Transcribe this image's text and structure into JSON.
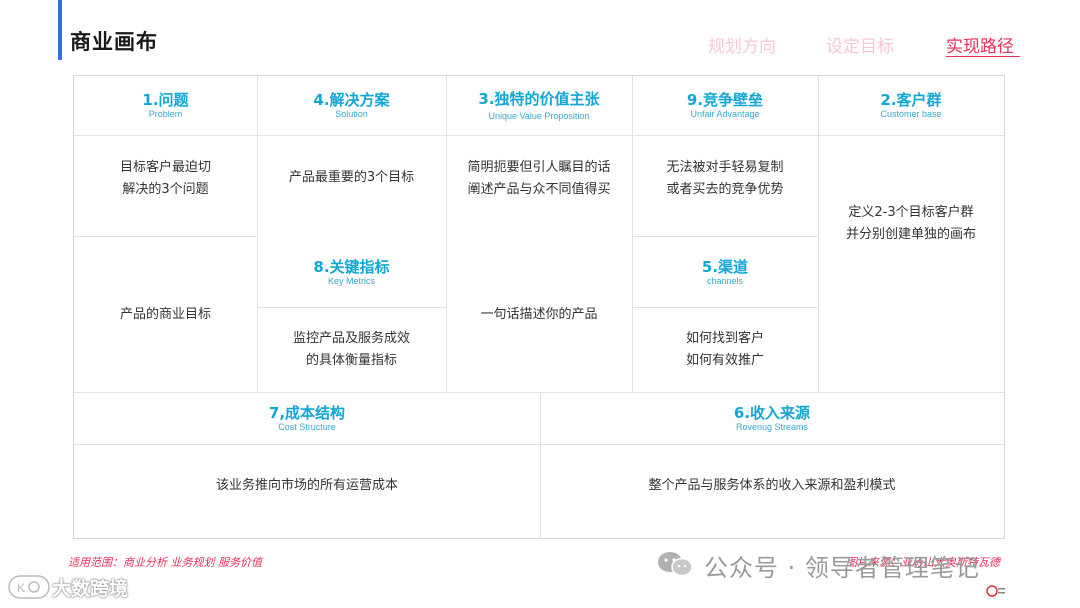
{
  "header": {
    "title": "商业画布",
    "nav": [
      "规划方向",
      "设定目标",
      "实现路径"
    ],
    "active_nav": "实现路径"
  },
  "canvas": {
    "problem": {
      "title": "1.问题",
      "subtitle": "Problem",
      "body1": [
        "目标客户最迫切",
        "解决的3个问题"
      ],
      "body2": [
        "产品的商业目标"
      ]
    },
    "solution": {
      "title": "4.解决方案",
      "subtitle": "Solution",
      "body": [
        "产品最重要的3个目标"
      ]
    },
    "uvp": {
      "title": "3.独特的价值主张",
      "subtitle": "Unique  Value Proposition",
      "body1": [
        "简明扼要但引人瞩目的话",
        "阐述产品与众不同值得买"
      ],
      "body2": [
        "一句话描述你的产品"
      ]
    },
    "unfair": {
      "title": "9.竞争壁垒",
      "subtitle": "Unfair Advantage",
      "body": [
        "无法被对手轻易复制",
        "或者买去的竞争优势"
      ]
    },
    "customer": {
      "title": "2.客户群",
      "subtitle": "Customer base",
      "body": [
        "定义2-3个目标客户群",
        "并分别创建单独的画布"
      ]
    },
    "metrics": {
      "title": "8.关键指标",
      "subtitle": "Key Metrics",
      "body": [
        "监控产品及服务成效",
        "的具体衡量指标"
      ]
    },
    "channels": {
      "title": "5.渠道",
      "subtitle": "channels",
      "body": [
        "如何找到客户",
        "如何有效推广"
      ]
    },
    "cost": {
      "title": "7,成本结构",
      "subtitle": "Cost Structure",
      "body": [
        "该业务推向市场的所有运营成本"
      ]
    },
    "revenue": {
      "title": "6.收入来源",
      "subtitle": "Rovenug  Streams",
      "body": [
        "整个产品与服务体系的收入来源和盈利模式"
      ]
    }
  },
  "footer": {
    "scope": "适用范围：商业分析 业务规划 服务价值",
    "source": "图片来源：亚历山大奥斯特瓦德",
    "watermark": "公众号 · 领导者管理笔记",
    "bottom_left_watermark": "大数跨境"
  },
  "colors": {
    "accent_blue": "#2f6fe8",
    "heading_blue": "#12a6d6",
    "active_red": "#e8305a",
    "inactive_pink": "#f6c9d2"
  }
}
